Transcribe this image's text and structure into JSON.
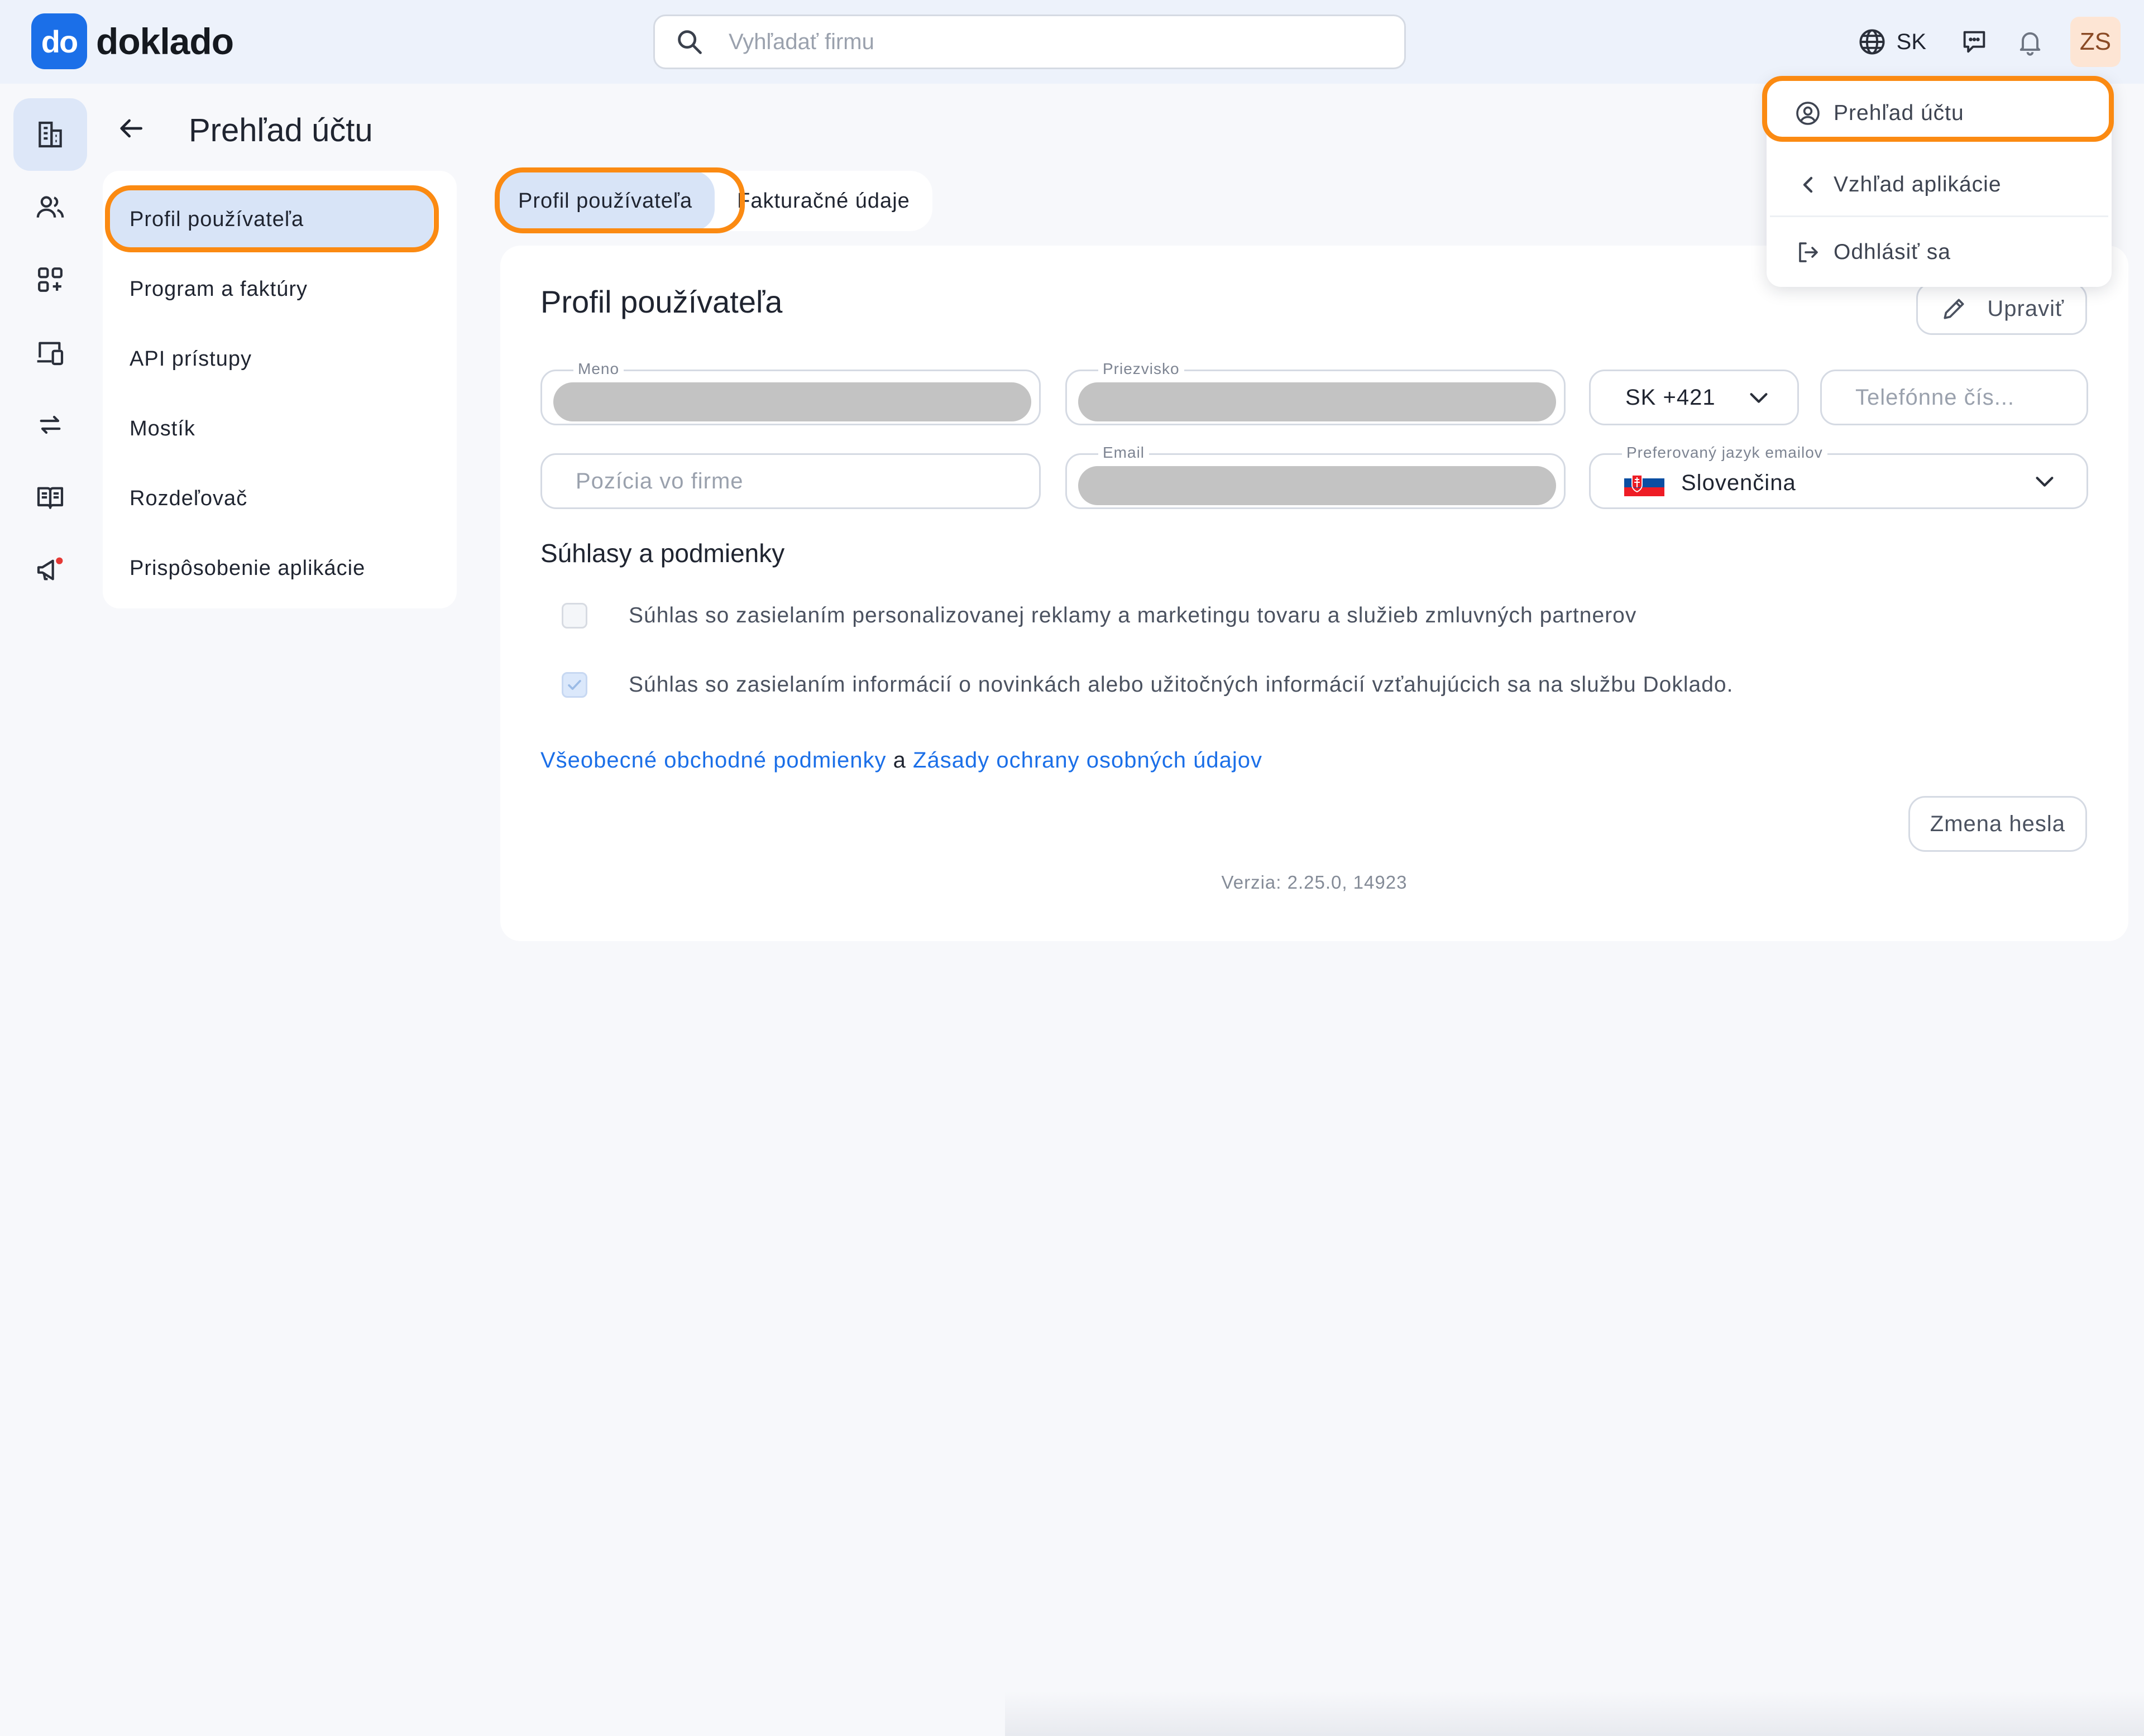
{
  "app": {
    "logo_badge": "do",
    "logo_text": "doklado",
    "brand_color": "#1b6fe8",
    "highlight_color": "#fb8a12"
  },
  "header": {
    "search_placeholder": "Vyhľadať firmu",
    "language": "SK",
    "avatar_initials": "ZS",
    "icons": [
      "globe-icon",
      "chat-icon",
      "bell-icon"
    ]
  },
  "rail": {
    "items": [
      {
        "icon": "building-icon",
        "active": true
      },
      {
        "icon": "users-icon"
      },
      {
        "icon": "apps-add-icon"
      },
      {
        "icon": "devices-icon"
      },
      {
        "icon": "transfer-arrows-icon"
      },
      {
        "icon": "book-icon"
      },
      {
        "icon": "megaphone-icon",
        "badge": true
      }
    ]
  },
  "page": {
    "title": "Prehľad účtu"
  },
  "settings_nav": {
    "items": [
      {
        "label": "Profil používateľa",
        "active": true
      },
      {
        "label": "Program a faktúry"
      },
      {
        "label": "API prístupy"
      },
      {
        "label": "Mostík"
      },
      {
        "label": "Rozdeľovač"
      },
      {
        "label": "Prispôsobenie aplikácie"
      }
    ]
  },
  "tabs": [
    {
      "label": "Profil používateľa",
      "active": true
    },
    {
      "label": "Fakturačné údaje"
    }
  ],
  "profile": {
    "title": "Profil používateľa",
    "edit_label": "Upraviť",
    "fields": {
      "first_name_label": "Meno",
      "last_name_label": "Priezvisko",
      "phone_prefix": "SK +421",
      "phone_placeholder": "Telefónne čís...",
      "position_placeholder": "Pozícia vo firme",
      "email_label": "Email",
      "email_language_label": "Preferovaný jazyk emailov",
      "email_language_value": "Slovenčina"
    },
    "consents_title": "Súhlasy a podmienky",
    "consents": [
      {
        "text": "Súhlas so zasielaním personalizovanej reklamy a marketingu tovaru a služieb zmluvných partnerov",
        "checked": false
      },
      {
        "text": "Súhlas so zasielaním informácií o novinkách alebo užitočných informácií vzťahujúcich sa na službu Doklado.",
        "checked": true
      }
    ],
    "links": {
      "terms": "Všeobecné obchodné podmienky",
      "conjunction": "a",
      "privacy": "Zásady ochrany osobných údajov"
    },
    "change_password_label": "Zmena hesla",
    "version": "Verzia: 2.25.0, 14923"
  },
  "account_menu": {
    "items": [
      {
        "label": "Prehľad účtu",
        "icon": "user-circle-icon"
      },
      {
        "label": "Vzhľad aplikácie",
        "icon": "chevron-left-icon"
      },
      {
        "label": "Odhlásiť sa",
        "icon": "logout-icon"
      }
    ]
  }
}
